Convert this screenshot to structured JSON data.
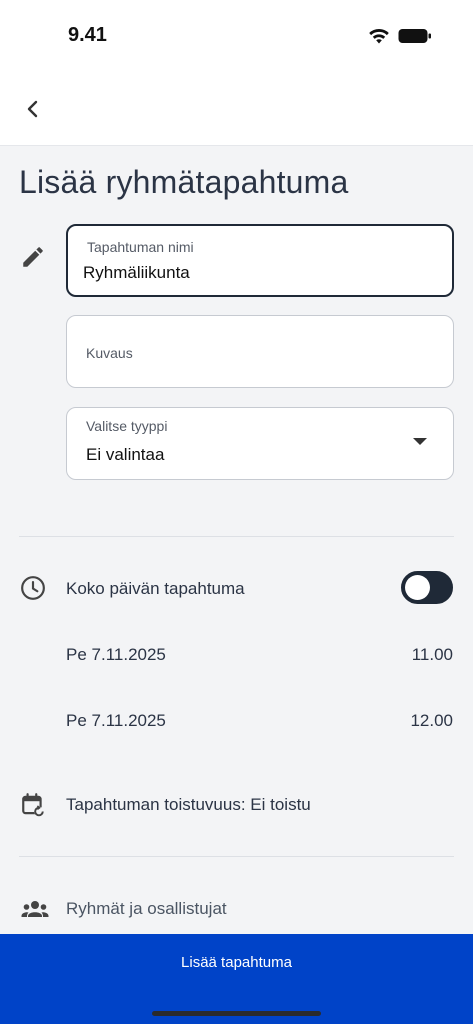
{
  "status_bar": {
    "time": "9.41",
    "icons": [
      "wifi-icon",
      "battery-icon"
    ]
  },
  "header": {
    "back_icon": "chevron-left-icon"
  },
  "page": {
    "title": "Lisää ryhmätapahtuma"
  },
  "form": {
    "name_field": {
      "label": "Tapahtuman nimi",
      "value": "Ryhmäliikunta"
    },
    "description_field": {
      "label": "Kuvaus",
      "value": ""
    },
    "type_field": {
      "label": "Valitse tyyppi",
      "value": "Ei valintaa"
    }
  },
  "all_day": {
    "label": "Koko päivän tapahtuma",
    "enabled": false
  },
  "start": {
    "date": "Pe 7.11.2025",
    "time": "11.00"
  },
  "end": {
    "date": "Pe 7.11.2025",
    "time": "12.00"
  },
  "recurrence": {
    "label": "Tapahtuman toistuvuus: Ei toistu"
  },
  "participants": {
    "label": "Ryhmät ja osallistujat"
  },
  "actions": {
    "submit_label": "Lisää tapahtuma"
  },
  "colors": {
    "primary": "#0043c8",
    "background": "#f3f4f6",
    "text": "#2b3445"
  }
}
